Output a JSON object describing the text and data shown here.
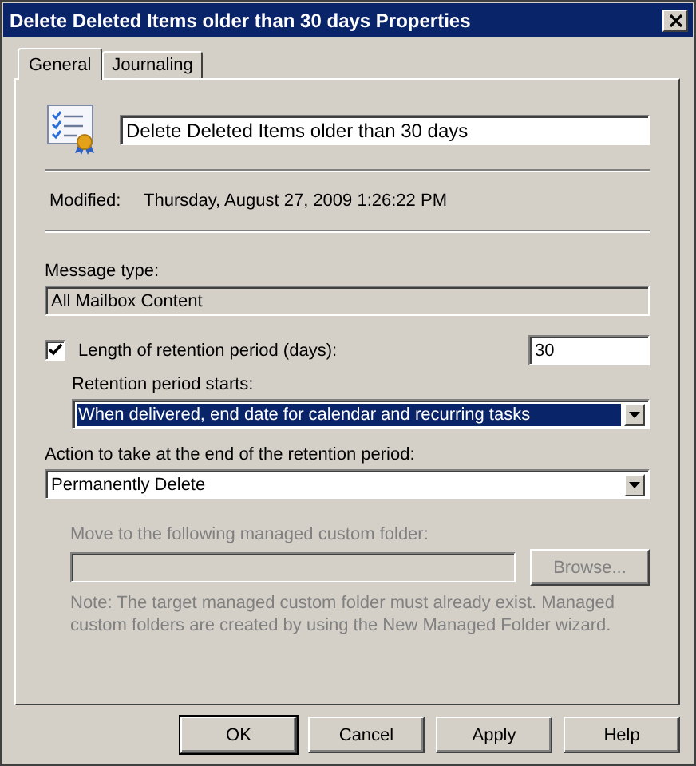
{
  "window": {
    "title": "Delete Deleted Items older than 30 days Properties"
  },
  "tabs": [
    {
      "label": "General",
      "selected": true
    },
    {
      "label": "Journaling",
      "selected": false
    }
  ],
  "general": {
    "name_field": {
      "value": "Delete Deleted Items older than 30 days"
    },
    "modified": {
      "label": "Modified:",
      "value": "Thursday, August 27, 2009 1:26:22 PM"
    },
    "message_type": {
      "label": "Message type:",
      "value": "All Mailbox Content"
    },
    "retention_length": {
      "label": "Length of retention period (days):",
      "checked": true,
      "value": "30"
    },
    "retention_start": {
      "label": "Retention period starts:",
      "value": "When delivered, end date for calendar and recurring tasks",
      "focused": true
    },
    "action": {
      "label": "Action to take at the end of the retention period:",
      "value": "Permanently Delete",
      "focused": false
    },
    "move_folder": {
      "label": "Move to the following managed custom folder:",
      "button": "Browse...",
      "disabled": true
    },
    "note": "Note: The target managed custom folder must already exist. Managed custom folders are created by using the New Managed Folder wizard."
  },
  "buttons": [
    {
      "label": "OK",
      "default": true
    },
    {
      "label": "Cancel",
      "default": false
    },
    {
      "label": "Apply",
      "default": false
    },
    {
      "label": "Help",
      "default": false
    }
  ]
}
